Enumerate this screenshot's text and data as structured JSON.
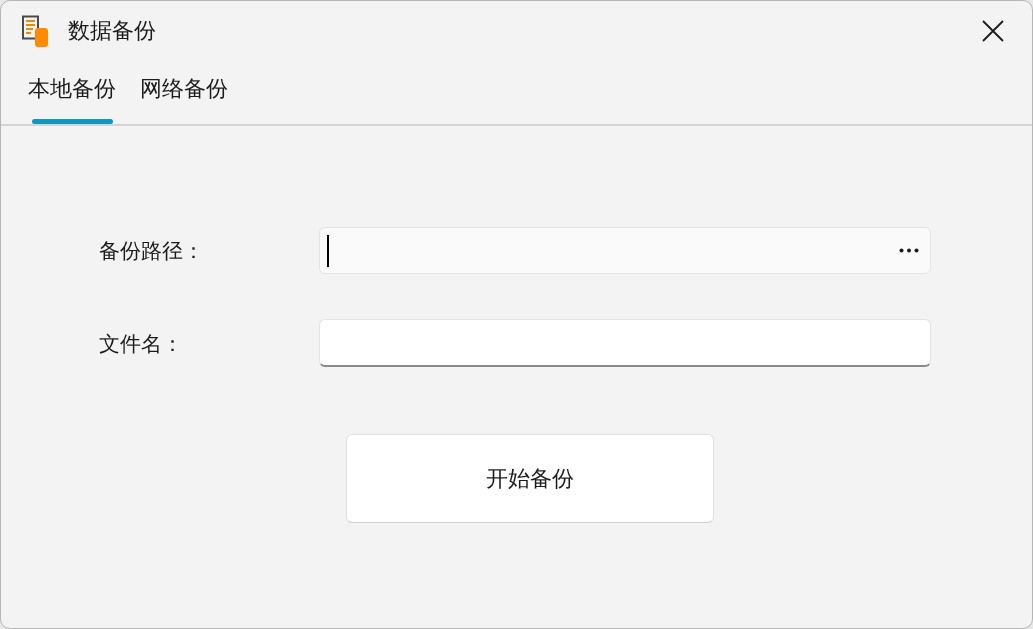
{
  "window": {
    "title": "数据备份"
  },
  "tabs": [
    {
      "label": "本地备份",
      "selected": true
    },
    {
      "label": "网络备份",
      "selected": false
    }
  ],
  "form": {
    "fields": [
      {
        "label": "备份路径：",
        "kind": "browse",
        "focused": true
      },
      {
        "label": "文件名：",
        "kind": "text",
        "focused": false
      }
    ]
  },
  "actions": [
    {
      "label": "开始备份"
    }
  ]
}
